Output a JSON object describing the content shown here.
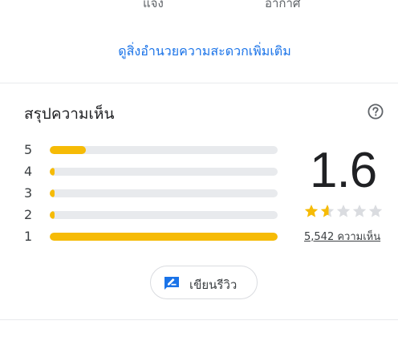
{
  "top_labels": {
    "left": "แจ้ง",
    "right": "อากาศ"
  },
  "more_link": "ดูสิ่งอำนวยความสะดวกเพิ่มเติม",
  "summary": {
    "title": "สรุปความเห็น",
    "help_icon": "help-circle-icon",
    "score": "1.6",
    "rating_value": 1.6,
    "stars_max": 5,
    "review_count": "5,542 ความเห็น",
    "histogram": [
      {
        "label": "5",
        "fraction": 0.16
      },
      {
        "label": "4",
        "fraction": 0.02
      },
      {
        "label": "3",
        "fraction": 0.02
      },
      {
        "label": "2",
        "fraction": 0.02
      },
      {
        "label": "1",
        "fraction": 1.0
      }
    ],
    "colors": {
      "bar_fill": "#f6bb06",
      "bar_track": "#e8eaed",
      "star_filled": "#f6bb06",
      "star_empty": "#dadce0",
      "link": "#1a73e8"
    }
  },
  "write_review": {
    "label": "เขียนรีวิว",
    "icon": "rate-review-icon"
  }
}
